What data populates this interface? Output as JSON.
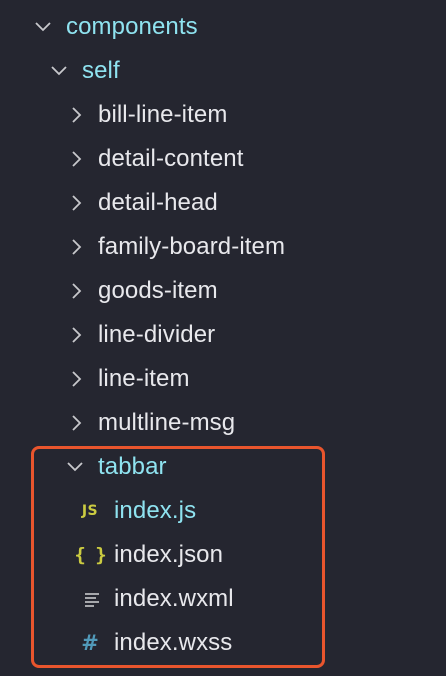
{
  "explorer": {
    "tree": [
      {
        "label": "components",
        "type": "folder",
        "expanded": true,
        "depth": 0
      },
      {
        "label": "self",
        "type": "folder",
        "expanded": true,
        "depth": 1
      },
      {
        "label": "bill-line-item",
        "type": "folder",
        "expanded": false,
        "depth": 2
      },
      {
        "label": "detail-content",
        "type": "folder",
        "expanded": false,
        "depth": 2
      },
      {
        "label": "detail-head",
        "type": "folder",
        "expanded": false,
        "depth": 2
      },
      {
        "label": "family-board-item",
        "type": "folder",
        "expanded": false,
        "depth": 2
      },
      {
        "label": "goods-item",
        "type": "folder",
        "expanded": false,
        "depth": 2
      },
      {
        "label": "line-divider",
        "type": "folder",
        "expanded": false,
        "depth": 2
      },
      {
        "label": "line-item",
        "type": "folder",
        "expanded": false,
        "depth": 2
      },
      {
        "label": "multline-msg",
        "type": "folder",
        "expanded": false,
        "depth": 2
      },
      {
        "label": "tabbar",
        "type": "folder",
        "expanded": true,
        "depth": 2
      },
      {
        "label": "index.js",
        "type": "file",
        "icon": "js-file-icon",
        "icon_text": "JS",
        "depth": 3
      },
      {
        "label": "index.json",
        "type": "file",
        "icon": "json-file-icon",
        "icon_text": "{ }",
        "depth": 3
      },
      {
        "label": "index.wxml",
        "type": "file",
        "icon": "lines-file-icon",
        "depth": 3
      },
      {
        "label": "index.wxss",
        "type": "file",
        "icon": "hash-file-icon",
        "icon_text": "#",
        "depth": 3
      }
    ]
  },
  "colors": {
    "background": "#252630",
    "text": "#e8e8ec",
    "expanded_folder_text": "#8fe3f0",
    "chevron": "#c8c8cc",
    "highlight_border": "#e9552d",
    "js_icon": "#cbcb41",
    "json_icon": "#cbcb41",
    "wxml_icon": "#c8c8cc",
    "wxss_icon": "#519aba"
  }
}
